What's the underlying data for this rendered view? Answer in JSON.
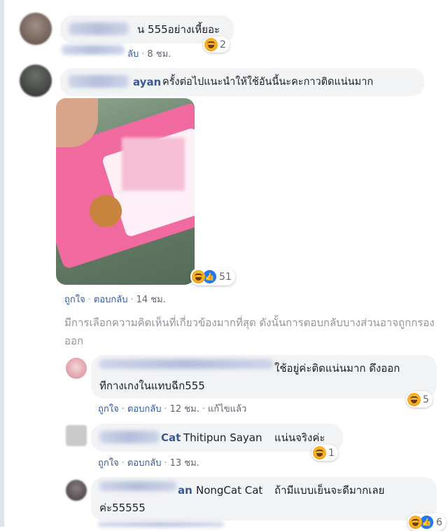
{
  "comment1": {
    "text_tail": "น 555อย่างเหี้ยอะ",
    "reply": "ลับ",
    "time": "8 ชม.",
    "reaction_count": "2"
  },
  "comment2": {
    "name_tail": "ayan",
    "text": "ครั้งต่อไปแนะนำให้ใช้อันนี้นะคะกาวติดแน่นมาก",
    "like": "ถูกใจ",
    "reply": "ตอบกลับ",
    "time": "14 ชม.",
    "reaction_count": "51"
  },
  "notice": "มีการเลือกความคิดเห็นที่เกี่ยวข้องมากที่สุด ดังนั้นการตอบกลับบางส่วนอาจถูกกรองออก",
  "reply1": {
    "text_line1": "ใช้อยู่ค่ะติดแน่นมาก ดึงออก",
    "text_line2": "ทีกางเกงในแทบฉีก555",
    "like": "ถูกใจ",
    "reply": "ตอบกลับ",
    "time": "12 ชม.",
    "edited": "แก้ไขแล้ว",
    "reaction_count": "5"
  },
  "reply2": {
    "name_tail": "Cat",
    "tag": "Thitipun Sayan",
    "text": "แน่นจริงค่ะ",
    "like": "ถูกใจ",
    "reply": "ตอบกลับ",
    "time": "13 ชม.",
    "reaction_count": "1"
  },
  "reply3": {
    "name_tail": "an",
    "tag": "NongCat Cat",
    "text_line1": "ถ้ามีแบบเย็นจะดีมากเลย",
    "text_line2": "ค่ะ55555",
    "reaction_count": "6"
  },
  "icons": {
    "haha": "haha-emoji-icon",
    "like": "like-thumb-icon"
  }
}
